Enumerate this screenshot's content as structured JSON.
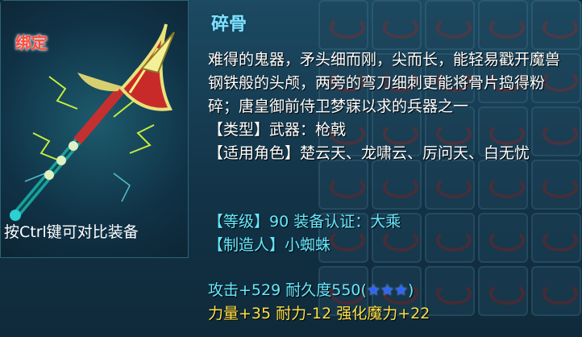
{
  "item": {
    "bind_label": "绑定",
    "hint": "按Ctrl键可对比装备",
    "name": "碎骨",
    "description": "难得的鬼器，矛头细而刚，尖而长，能轻易戳开魔兽钢铁般的头颅，两旁的弯刀细刺更能将骨片捣得粉碎；唐皇御前侍卫梦寐以求的兵器之一",
    "type_label": "【类型】",
    "type_value": "武器：枪戟",
    "role_label": "【适用角色】",
    "role_value": "楚云天、龙啸云、厉问天、白无忧",
    "level_label": "【等级】",
    "level_value": "90",
    "cert_label": "装备认证：",
    "cert_value": "大乘",
    "maker_label": "【制造人】",
    "maker_value": "小蜘蛛",
    "attack": "攻击+529",
    "durability": "耐久度550(",
    "stars": "★★★",
    "durability_close": ")",
    "strength": "力量+35",
    "endurance": "耐力-12",
    "magic": "强化魔力+22"
  },
  "colors": {
    "bind": "#ff4a3a",
    "title": "#7fe3ff",
    "stat_cyan": "#67e9ff",
    "stat_yellow": "#ffe046"
  },
  "icons": {
    "weapon": "halberd-icon"
  }
}
